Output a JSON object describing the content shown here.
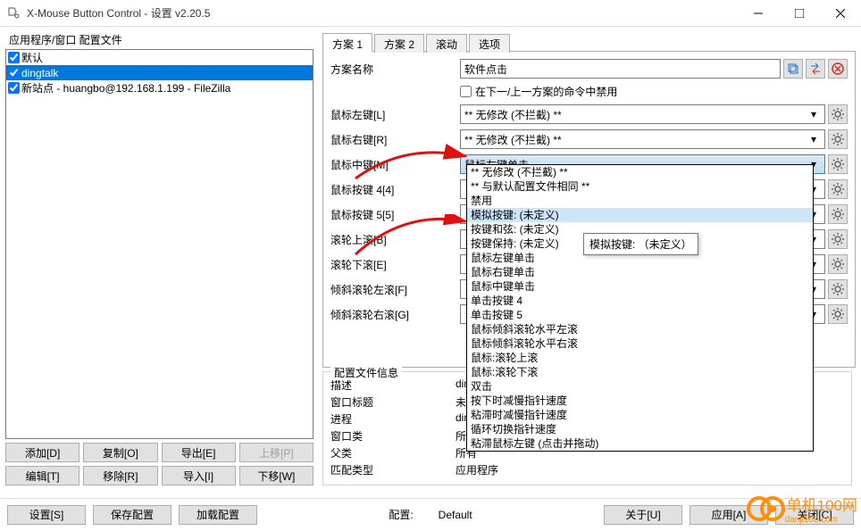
{
  "window": {
    "title": "X-Mouse Button Control - 设置 v2.20.5"
  },
  "left": {
    "group_label": "应用程序/窗口 配置文件",
    "profiles": [
      {
        "label": "默认",
        "checked": true,
        "selected": false
      },
      {
        "label": "dingtalk",
        "checked": true,
        "selected": true
      },
      {
        "label": "新站点 - huangbo@192.168.1.199 - FileZilla",
        "checked": true,
        "selected": false
      }
    ],
    "buttons": {
      "add": "添加[D]",
      "copy": "复制[O]",
      "export": "导出[E]",
      "moveup": "上移[P]",
      "edit": "编辑[T]",
      "remove": "移除[R]",
      "import": "导入[I]",
      "movedown": "下移[W]"
    }
  },
  "tabs": {
    "items": [
      "方案 1",
      "方案 2",
      "滚动",
      "选项"
    ],
    "active": 0
  },
  "form": {
    "name_label": "方案名称",
    "name_value": "软件点击",
    "disable_checkbox": "在下一/上一方案的命令中禁用",
    "rows": [
      {
        "label": "鼠标左键[L]",
        "value": "** 无修改 (不拦截) **",
        "open": false
      },
      {
        "label": "鼠标右键[R]",
        "value": "** 无修改 (不拦截) **",
        "open": false
      },
      {
        "label": "鼠标中键[M]",
        "value": "鼠标左键单击",
        "open": true
      },
      {
        "label": "鼠标按键 4[4]",
        "value": "",
        "open": false
      },
      {
        "label": "鼠标按键 5[5]",
        "value": "",
        "open": false
      },
      {
        "label": "滚轮上滚[B]",
        "value": "",
        "open": false
      },
      {
        "label": "滚轮下滚[E]",
        "value": "",
        "open": false
      },
      {
        "label": "倾斜滚轮左滚[F]",
        "value": "",
        "open": false
      },
      {
        "label": "倾斜滚轮右滚[G]",
        "value": "",
        "open": false
      }
    ]
  },
  "dropdown": {
    "items": [
      "** 无修改 (不拦截) **",
      "** 与默认配置文件相同 **",
      "禁用",
      "模拟按键: (未定义)",
      "按键和弦: (未定义)",
      "按键保持: (未定义)",
      "鼠标左键单击",
      "鼠标右键单击",
      "鼠标中键单击",
      "单击按键 4",
      "单击按键 5",
      "鼠标倾斜滚轮水平左滚",
      "鼠标倾斜滚轮水平右滚",
      "鼠标:滚轮上滚",
      "鼠标:滚轮下滚",
      "双击",
      "按下时减慢指针速度",
      "粘滞时减慢指针速度",
      "循环切换指针速度",
      "粘滞鼠标左键 (点击并拖动)"
    ],
    "highlighted": 3,
    "tooltip": "模拟按键: （未定义）"
  },
  "profile_info": {
    "legend": "配置文件信息",
    "rows": [
      {
        "label": "描述",
        "value": "ding"
      },
      {
        "label": "窗口标题",
        "value": "未定"
      },
      {
        "label": "进程",
        "value": "ding"
      },
      {
        "label": "窗口类",
        "value": "所有"
      },
      {
        "label": "父类",
        "value": "所有"
      },
      {
        "label": "匹配类型",
        "value": "应用程序"
      }
    ]
  },
  "bottom": {
    "settings": "设置[S]",
    "save": "保存配置",
    "load": "加载配置",
    "cfg_label": "配置:",
    "cfg_value": "Default",
    "about": "关于[U]",
    "apply": "应用[A]",
    "close": "关闭[C]"
  },
  "watermark": {
    "text": "单机100网",
    "sub": "danji100.com"
  }
}
